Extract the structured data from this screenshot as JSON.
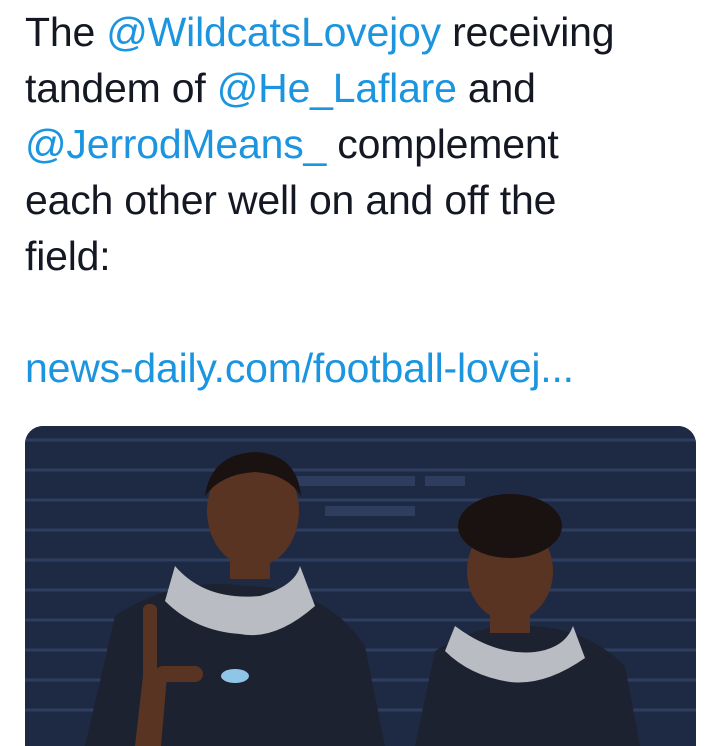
{
  "tweet": {
    "text_before_mention1": "The ",
    "mention1": "@WildcatsLovejoy",
    "text_after_mention1": " receiving",
    "text_line2_start": "tandem of ",
    "mention2": "@He_Laflare",
    "text_after_mention2": " and",
    "mention3": "@JerrodMeans_",
    "text_after_mention3": " complement",
    "text_line4": "each other well on and off the",
    "text_line5": "field:",
    "link": "news-daily.com/football-lovej..."
  },
  "media": {
    "description_icon": "photo-two-football-players",
    "colors": {
      "wall": "#1e2a44",
      "hoodie": "#b9bcc2",
      "jersey": "#1d2230",
      "skin": "#5a3422"
    }
  }
}
